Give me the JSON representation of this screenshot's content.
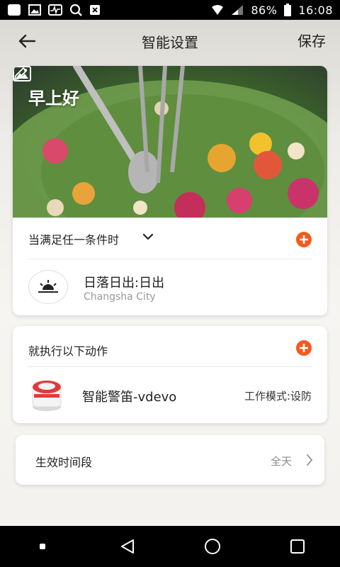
{
  "statusbar": {
    "battery": "86%",
    "time": "16:08"
  },
  "header": {
    "title": "智能设置",
    "save_label": "保存"
  },
  "scene": {
    "greeting": "早上好"
  },
  "condition": {
    "label": "当满足任一条件时",
    "item_title": "日落日出:日出",
    "item_location": "Changsha City"
  },
  "action": {
    "label": "就执行以下动作",
    "device_name": "智能警笛-vdevo",
    "device_mode": "工作模式:设防"
  },
  "effective_period": {
    "label": "生效时间段",
    "value": "全天"
  },
  "colors": {
    "accent": "#f45a1e"
  }
}
